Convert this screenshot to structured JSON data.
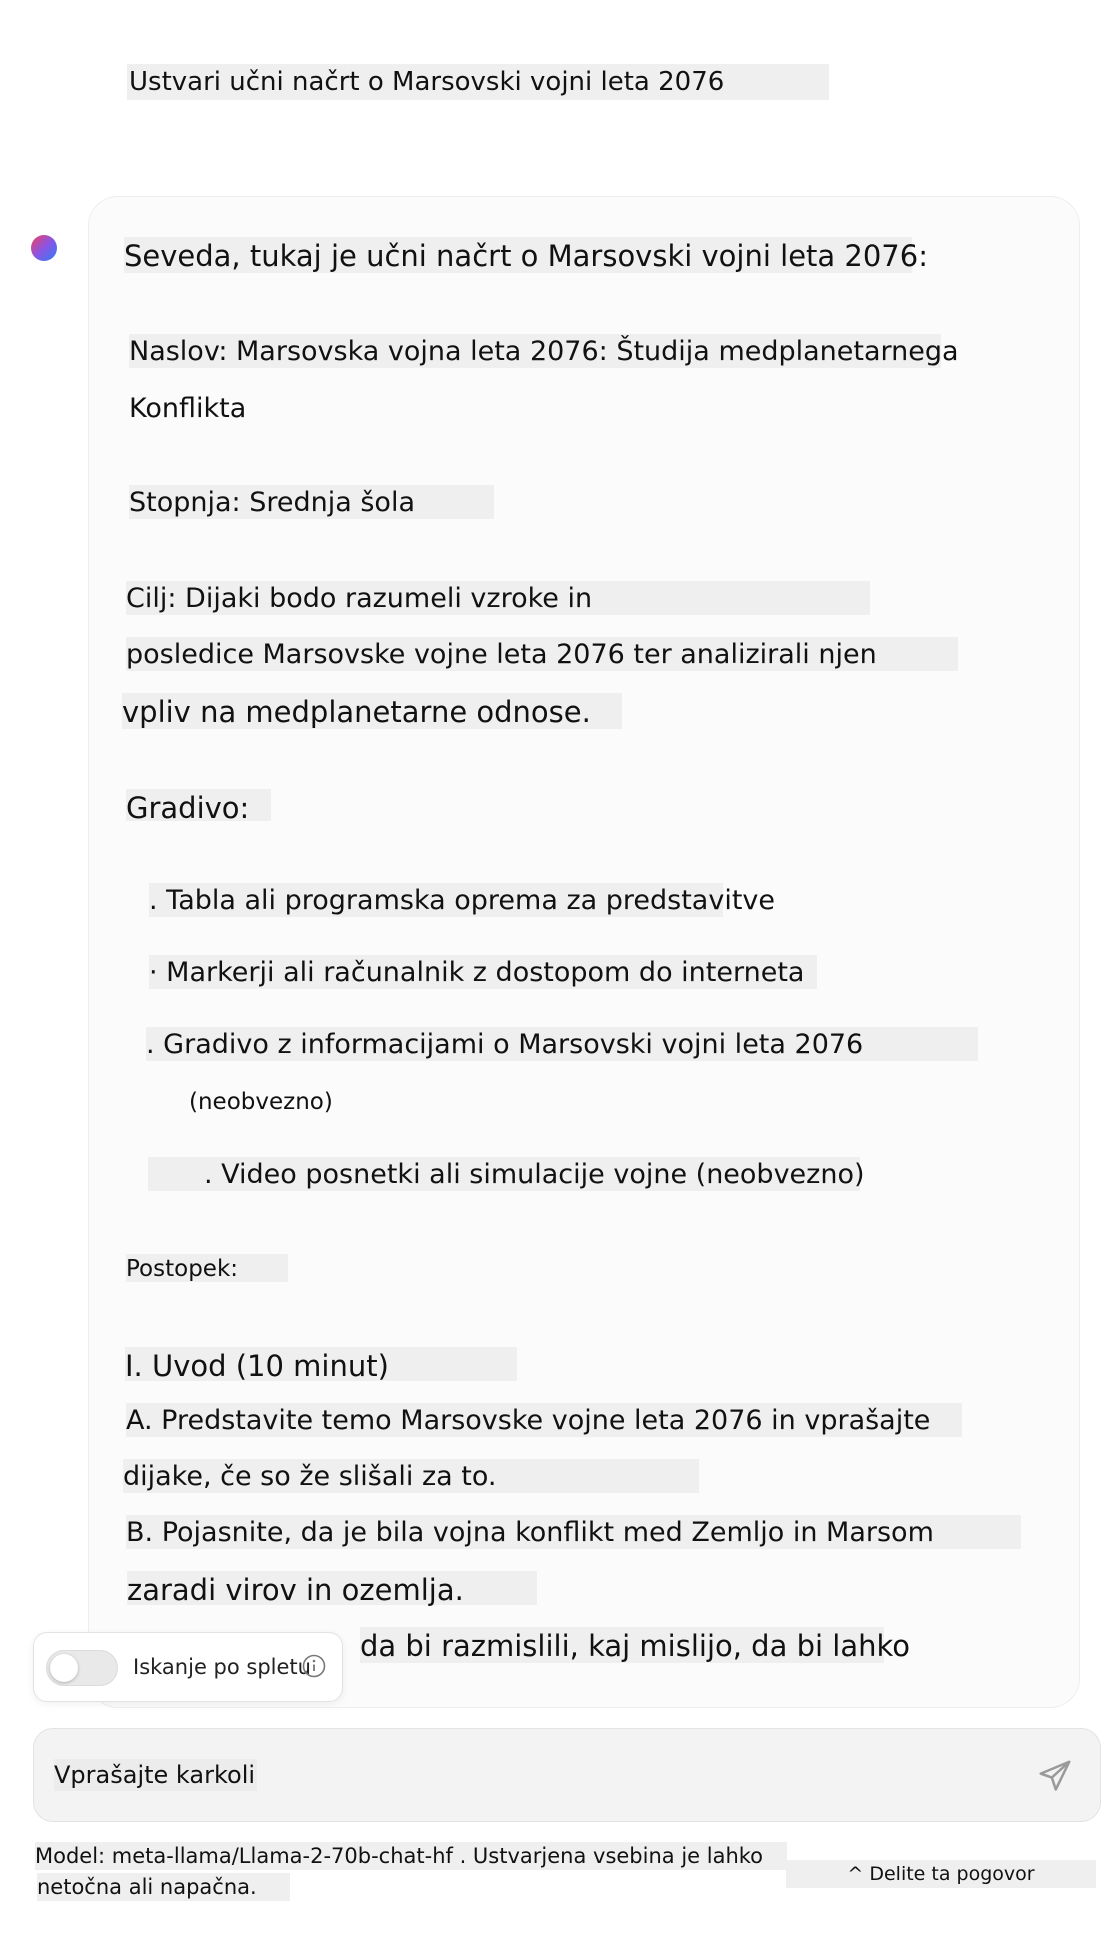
{
  "user_message": "Ustvari učni načrt o Marsovski vojni leta 2076",
  "assistant": {
    "intro": "Seveda, tukaj je učni načrt o Marsovski vojni leta 2076:",
    "title_line1": "Naslov: Marsovska vojna leta 2076: Študija medplanetarnega",
    "title_line2": "Konflikta",
    "level": "Stopnja: Srednja šola",
    "goal_line1": "Cilj: Dijaki bodo razumeli vzroke in",
    "goal_line2": "posledice Marsovske vojne leta 2076 ter analizirali njen",
    "goal_line3": "vpliv na medplanetarne odnose.",
    "materials_heading": "Gradivo:",
    "material_1": ". Tabla ali programska oprema za predstavitve",
    "material_2": "· Markerji ali računalnik z dostopom do interneta",
    "material_3_line1": ". Gradivo z informacijami o Marsovski vojni leta 2076",
    "material_3_line2": "(neobvezno)",
    "material_4": ". Video posnetki ali simulacije vojne (neobvezno)",
    "procedure_heading": "Postopek:",
    "section_1": "I. Uvod (10 minut)",
    "step_a_line1": "A. Predstavite temo Marsovske vojne leta 2076 in vprašajte",
    "step_a_line2": "dijake, če so že slišali za to.",
    "step_b_line1": "B. Pojasnite, da je bila vojna konflikt med Zemljo in Marsom",
    "step_b_line2": "zaradi virov in ozemlja.",
    "step_c_partial": "da bi razmislili, kaj mislijo, da bi lahko"
  },
  "web_search_toggle": {
    "label": "Iskanje po spletu",
    "enabled": false
  },
  "input": {
    "placeholder": "Vprašajte karkoli"
  },
  "footer": {
    "model_line1": "Model: meta-llama/Llama-2-70b-chat-hf . Ustvarjena vsebina je lahko",
    "model_line2": "netočna ali napačna.",
    "share_label": "^ Delite ta pogovor"
  },
  "icons": {
    "avatar": "assistant-avatar",
    "info": "info-icon",
    "send": "send-icon"
  }
}
